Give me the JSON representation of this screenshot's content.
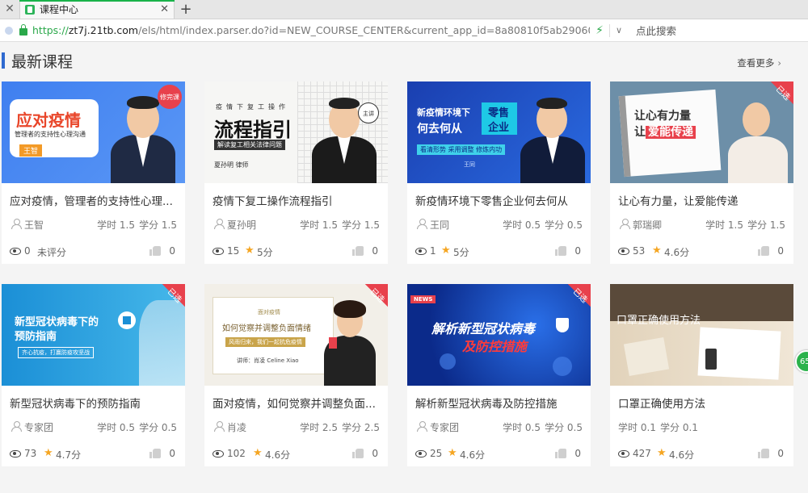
{
  "browser": {
    "tab_title": "课程中心",
    "url_proto": "https://",
    "url_host": "zt7j.21tb.com",
    "url_path": "/els/html/index.parser.do?id=NEW_COURSE_CENTER&current_app_id=8a80810f5ab29060015ad1906d0b38",
    "search_label": "点此搜索"
  },
  "section": {
    "title": "最新课程",
    "more_label": "查看更多"
  },
  "courses": [
    {
      "title": "应对疫情，管理者的支持性心理...",
      "lecturer": "王智",
      "hours": "学时 1.5",
      "credits": "学分 1.5",
      "views": "0",
      "rating": "未评分",
      "likes": "0",
      "thumb": {
        "line1": "应对疫情",
        "line2": "管理者的支持性心理沟通",
        "name": "王智",
        "badge": "修完课"
      }
    },
    {
      "title": "疫情下复工操作流程指引",
      "lecturer": "夏孙明",
      "hours": "学时 1.5",
      "credits": "学分 1.5",
      "views": "15",
      "rating": "5分",
      "likes": "0",
      "thumb": {
        "top": "疫情下复工操作",
        "big": "流程指引",
        "sub": "解读复工相关法律问题",
        "name": "夏孙明 律师"
      }
    },
    {
      "title": "新疫情环境下零售企业何去何从",
      "lecturer": "王同",
      "hours": "学时 0.5",
      "credits": "学分 0.5",
      "views": "1",
      "rating": "5分",
      "likes": "0",
      "thumb": {
        "l1": "新疫情环境下",
        "l2": "何去何从",
        "r1": "零售",
        "r2": "企业",
        "tag": "看清形势 采用调整 修炼内功",
        "name": "王同"
      }
    },
    {
      "title": "让心有力量，让爱能传递",
      "lecturer": "郭瑞卿",
      "hours": "学时 1.5",
      "credits": "学分 1.5",
      "views": "53",
      "rating": "4.6分",
      "likes": "0",
      "thumb": {
        "l1": "让心有力量",
        "l2a": "让",
        "l2b": "爱能传递",
        "badge": "已选"
      }
    },
    {
      "title": "新型冠状病毒下的预防指南",
      "lecturer": "专家团",
      "hours": "学时 0.5",
      "credits": "学分 0.5",
      "views": "73",
      "rating": "4.7分",
      "likes": "0",
      "thumb": {
        "l1": "新型冠状病毒下的",
        "l2": "预防指南",
        "tag": "齐心抗疫，打赢防疫攻坚战",
        "badge": "已选"
      }
    },
    {
      "title": "面对疫情，如何觉察并调整负面...",
      "lecturer": "肖凌",
      "hours": "学时 2.5",
      "credits": "学分 2.5",
      "views": "102",
      "rating": "4.6分",
      "likes": "0",
      "thumb": {
        "top": "面对疫情",
        "l1": "如何觉察并调整负面情绪",
        "l2": "风雨归来，我们一起抗危疫情",
        "name": "讲师：肖凌 Celine Xiao",
        "badge": "已选"
      }
    },
    {
      "title": "解析新型冠状病毒及防控措施",
      "lecturer": "专家团",
      "hours": "学时 0.5",
      "credits": "学分 0.5",
      "views": "25",
      "rating": "4.6分",
      "likes": "0",
      "thumb": {
        "news": "NEWS",
        "l1": "解析新型冠状病毒",
        "l2": "及防控措施",
        "badge": "已选"
      }
    },
    {
      "title": "口罩正确使用方法",
      "lecturer": "",
      "hours": "学时 0.1",
      "credits": "学分 0.1",
      "views": "427",
      "rating": "4.6分",
      "likes": "0",
      "thumb": {
        "l1": "口罩正确使用方法"
      }
    }
  ],
  "float_ball": "65"
}
